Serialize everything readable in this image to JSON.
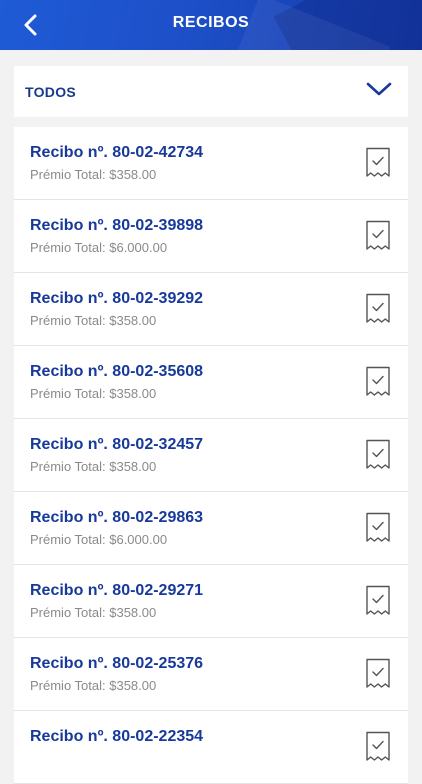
{
  "header": {
    "title": "RECIBOS",
    "back_icon": "chevron-left-icon",
    "color": "#1f55d0"
  },
  "filter": {
    "selected": "TODOS",
    "icon": "chevron-down-icon"
  },
  "receipts": [
    {
      "title": "Recibo nº. 80-02-42734",
      "premium": "Prémio Total: $358.00",
      "icon": "receipt-icon"
    },
    {
      "title": "Recibo nº. 80-02-39898",
      "premium": "Prémio Total: $6.000.00",
      "icon": "receipt-icon"
    },
    {
      "title": "Recibo nº. 80-02-39292",
      "premium": "Prémio Total: $358.00",
      "icon": "receipt-icon"
    },
    {
      "title": "Recibo nº. 80-02-35608",
      "premium": "Prémio Total: $358.00",
      "icon": "receipt-icon"
    },
    {
      "title": "Recibo nº. 80-02-32457",
      "premium": "Prémio Total: $358.00",
      "icon": "receipt-icon"
    },
    {
      "title": "Recibo nº. 80-02-29863",
      "premium": "Prémio Total: $6.000.00",
      "icon": "receipt-icon"
    },
    {
      "title": "Recibo nº. 80-02-29271",
      "premium": "Prémio Total: $358.00",
      "icon": "receipt-icon"
    },
    {
      "title": "Recibo nº. 80-02-25376",
      "premium": "Prémio Total: $358.00",
      "icon": "receipt-icon"
    },
    {
      "title": "Recibo nº. 80-02-22354",
      "premium": "",
      "icon": "receipt-icon"
    }
  ],
  "colors": {
    "accent": "#17399a",
    "background": "#f2f2f2",
    "muted_text": "#8a8a8a"
  }
}
